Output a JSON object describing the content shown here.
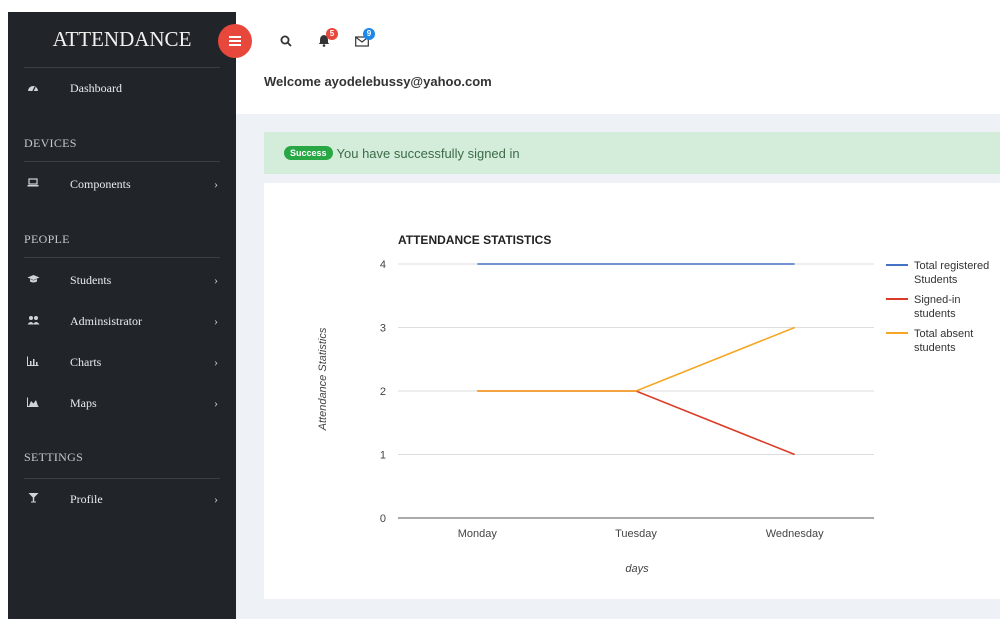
{
  "sidebar": {
    "brand": "ATTENDANCE",
    "items": [
      {
        "label": "Dashboard",
        "icon": "dashboard-gauge-icon",
        "has_chevron": false
      },
      {
        "label": "Components",
        "icon": "laptop-icon",
        "has_chevron": true
      },
      {
        "label": "Students",
        "icon": "graduation-cap-icon",
        "has_chevron": true
      },
      {
        "label": "Adminsistrator",
        "icon": "users-icon",
        "has_chevron": true
      },
      {
        "label": "Charts",
        "icon": "bar-chart-icon",
        "has_chevron": true
      },
      {
        "label": "Maps",
        "icon": "area-chart-icon",
        "has_chevron": true
      },
      {
        "label": "Profile",
        "icon": "cocktail-glass-icon",
        "has_chevron": true
      }
    ],
    "sections": [
      "DEVICES",
      "PEOPLE",
      "SETTINGS"
    ]
  },
  "topbar": {
    "notifications_count": "5",
    "messages_count": "9",
    "badge_colors": {
      "notifications": "#e8473b",
      "messages": "#1e88e5"
    }
  },
  "welcome_text": "Welcome ayodelebussy@yahoo.com",
  "alert": {
    "badge": "Success",
    "message": "You have successfully signed in"
  },
  "chart_data": {
    "type": "line",
    "title": "ATTENDANCE STATISTICS",
    "xlabel": "days",
    "ylabel": "Attendance Statistics",
    "categories": [
      "Monday",
      "Tuesday",
      "Wednesday"
    ],
    "ylim": [
      0,
      4
    ],
    "yticks": [
      "0",
      "1",
      "2",
      "3",
      "4"
    ],
    "grid": true,
    "legend": "right",
    "series": [
      {
        "name": "Total registered Students",
        "values": [
          4,
          4,
          4
        ],
        "color": "#4472c4"
      },
      {
        "name": "Signed-in students",
        "values": [
          2,
          2,
          1
        ],
        "color": "#db3b26"
      },
      {
        "name": "Total absent students",
        "values": [
          2,
          2,
          3
        ],
        "color": "#f5a623"
      }
    ]
  }
}
